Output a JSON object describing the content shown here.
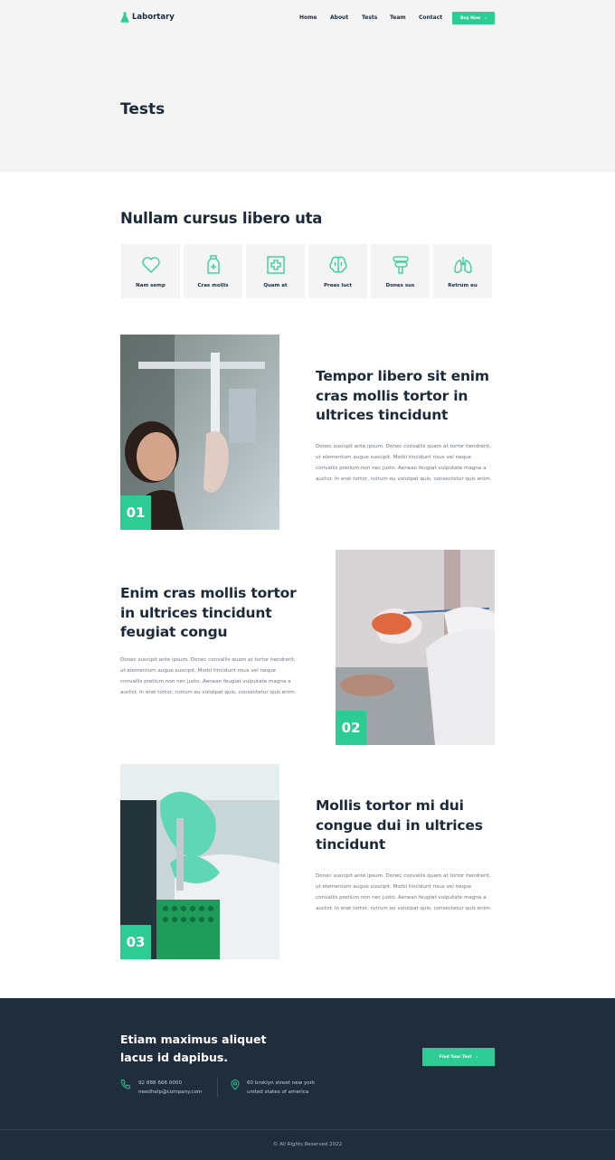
{
  "header": {
    "brand": "Labortary",
    "nav": [
      "Home",
      "About",
      "Tests",
      "Team",
      "Contact"
    ],
    "buy_label": "Buy Now",
    "page_title": "Tests"
  },
  "categories": {
    "title": "Nullam cursus libero uta",
    "items": [
      {
        "label": "Nam semp",
        "icon": "heart-icon"
      },
      {
        "label": "Cras mollis",
        "icon": "medicine-bottle-icon"
      },
      {
        "label": "Quam at",
        "icon": "first-aid-icon"
      },
      {
        "label": "Preas luct",
        "icon": "brain-icon"
      },
      {
        "label": "Dones sus",
        "icon": "intestine-icon"
      },
      {
        "label": "Retrum eu",
        "icon": "lungs-icon"
      }
    ]
  },
  "features": [
    {
      "number": "01",
      "title": "Tempor libero sit enim cras mollis tortor in ultrices tincidunt",
      "text": "Donec suscipit ante ipsum. Donec convallis quam at tortor hendrerit, ut elementum augue suscipit. Morbi tincidunt risus vel neque convallis pretium non nec justo.  Aenean feugiat vulputate magna a auctor. In erat tortor, rutrum eu volutpat quis, consectetur quis enim."
    },
    {
      "number": "02",
      "title": "Enim cras mollis tortor in ultrices tincidunt feugiat congu",
      "text": "Donec suscipit ante ipsum. Donec convallis quam at tortor hendrerit, ut elementum augue suscipit. Morbi tincidunt risus vel neque convallis pretium non nec justo.  Aenean feugiat vulputate magna a auctor. In erat tortor, rutrum eu volutpat quis, consectetur quis enim."
    },
    {
      "number": "03",
      "title": "Mollis tortor mi dui congue dui in ultrices tincidunt",
      "text": "Donec suscipit ante ipsum. Donec convallis quam at tortor hendrerit, ut elementum augue suscipit. Morbi tincidunt risus vel neque convallis pretium non nec justo.  Aenean feugiat vulputate magna a auctor. In erat tortor, rutrum eu volutpat quis, consectetur quis enim."
    }
  ],
  "footer": {
    "cta": "Etiam maximus aliquet lacus id dapibus.",
    "button_label": "Find Your Test",
    "phone": "92 888 666 0000",
    "email": "needhelp@company.com",
    "address_line1": "60 broklyn street new york",
    "address_line2": "united states of america",
    "copyright": "© All Rights Reserved 2022"
  },
  "colors": {
    "accent": "#2ecc95",
    "dark": "#1f2d3d",
    "heading": "#1b2a3a",
    "light_bg": "#f4f4f5"
  }
}
